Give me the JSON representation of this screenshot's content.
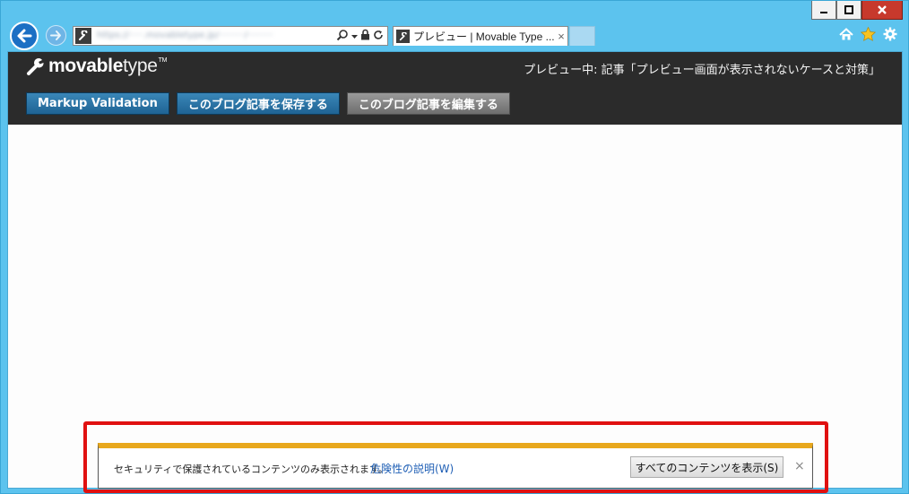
{
  "browser": {
    "address_blurred": "https://·····.movabletype.jp/·········/·········",
    "tab_title": "プレビュー | Movable Type ...",
    "tab_close": "×",
    "search_icon": "search-icon",
    "lock_icon": "lock-icon",
    "refresh_icon": "refresh-icon"
  },
  "mt": {
    "logo_bold": "movable",
    "logo_light": "type",
    "logo_tm": "TM",
    "preview_title": "プレビュー中: 記事「プレビュー画面が表示されないケースと対策」",
    "buttons": {
      "validation": "Markup Validation",
      "save": "このブログ記事を保存する",
      "edit": "このブログ記事を編集する"
    }
  },
  "notification": {
    "message": "セキュリティで保護されているコンテンツのみ表示されます。",
    "link": "危険性の説明(W)",
    "button": "すべてのコンテンツを表示(S)",
    "close": "×"
  },
  "colors": {
    "accent_highlight": "#e01010",
    "notification_bar": "#e8a81d",
    "mt_header": "#2b2b2b",
    "mt_button_blue": "#1f6394",
    "mt_button_gray": "#6e6e6e"
  }
}
